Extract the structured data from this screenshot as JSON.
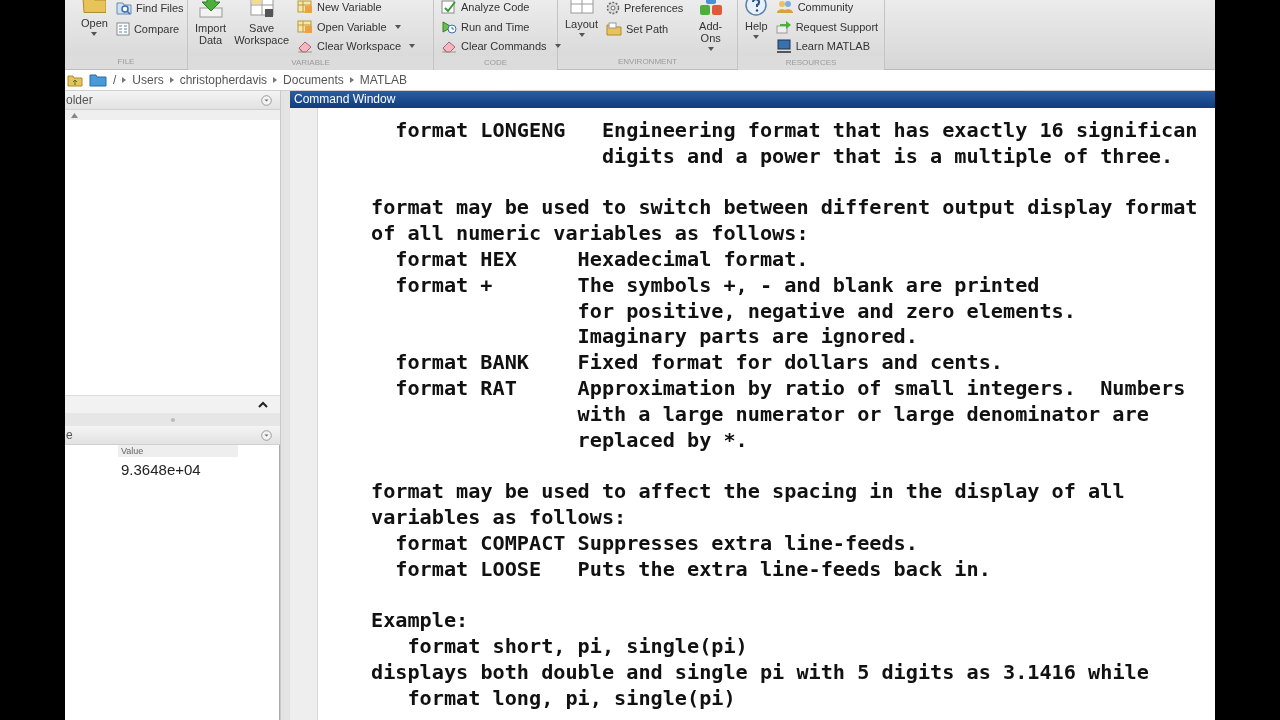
{
  "ribbon": {
    "groups": [
      {
        "label": "FILE",
        "items": [
          {
            "kind": "large",
            "label": [
              "Open"
            ],
            "caret": true
          },
          {
            "kind": "stack",
            "items": [
              {
                "label": "Find Files",
                "caret": false
              },
              {
                "label": "Compare",
                "caret": false
              }
            ]
          }
        ]
      },
      {
        "label": "VARIABLE",
        "items": [
          {
            "kind": "large",
            "label": [
              "Import",
              "Data"
            ],
            "caret": false
          },
          {
            "kind": "large",
            "label": [
              "Save",
              "Workspace"
            ],
            "caret": false
          },
          {
            "kind": "stack",
            "items": [
              {
                "label": "New Variable",
                "caret": false
              },
              {
                "label": "Open Variable",
                "caret": true
              },
              {
                "label": "Clear Workspace",
                "caret": true
              }
            ]
          }
        ]
      },
      {
        "label": "CODE",
        "items": [
          {
            "kind": "stack",
            "items": [
              {
                "label": "Analyze Code",
                "caret": false
              },
              {
                "label": "Run and Time",
                "caret": false
              },
              {
                "label": "Clear Commands",
                "caret": true
              }
            ]
          }
        ]
      },
      {
        "label": "ENVIRONMENT",
        "items": [
          {
            "kind": "large",
            "label": [
              "Layout"
            ],
            "caret": true
          },
          {
            "kind": "stack",
            "items": [
              {
                "label": "Preferences",
                "caret": false
              },
              {
                "label": "Set Path",
                "caret": false
              }
            ]
          },
          {
            "kind": "large",
            "label": [
              "Add-Ons"
            ],
            "caret": true
          }
        ]
      },
      {
        "label": "RESOURCES",
        "items": [
          {
            "kind": "large",
            "label": [
              "Help"
            ],
            "caret": true
          },
          {
            "kind": "stack",
            "items": [
              {
                "label": "Community",
                "caret": false
              },
              {
                "label": "Request Support",
                "caret": false
              },
              {
                "label": "Learn MATLAB",
                "caret": false
              }
            ]
          }
        ]
      }
    ]
  },
  "address_bar": {
    "path": [
      "/",
      "Users",
      "christopherdavis",
      "Documents",
      "MATLAB"
    ]
  },
  "current_folder": {
    "title": "older"
  },
  "workspace": {
    "title": "e",
    "columns": [
      "Value"
    ],
    "rows": [
      [
        "9.3648e+04"
      ]
    ]
  },
  "command_window": {
    "title": "Command Window",
    "blocks": [
      {
        "kind": "option_wide",
        "name": "format LONGENG",
        "lines": [
          "Engineering format that has exactly 16 significan",
          "digits and a power that is a multiple of three."
        ]
      },
      {
        "kind": "blank"
      },
      {
        "kind": "text",
        "text": "format may be used to switch between different output display format"
      },
      {
        "kind": "text",
        "text": "of all numeric variables as follows:"
      },
      {
        "kind": "option",
        "name": "format HEX",
        "lines": [
          "Hexadecimal format."
        ]
      },
      {
        "kind": "option",
        "name": "format +",
        "lines": [
          "The symbols +, - and blank are printed",
          "for positive, negative and zero elements.",
          "Imaginary parts are ignored."
        ]
      },
      {
        "kind": "option",
        "name": "format BANK",
        "lines": [
          "Fixed format for dollars and cents."
        ]
      },
      {
        "kind": "option",
        "name": "format RAT",
        "lines": [
          "Approximation by ratio of small integers.  Numbers",
          "with a large numerator or large denominator are",
          "replaced by *."
        ]
      },
      {
        "kind": "blank"
      },
      {
        "kind": "text",
        "text": "format may be used to affect the spacing in the display of all"
      },
      {
        "kind": "text",
        "text": "variables as follows:"
      },
      {
        "kind": "option",
        "name": "format COMPACT",
        "lines": [
          "Suppresses extra line-feeds."
        ]
      },
      {
        "kind": "option",
        "name": "format LOOSE",
        "lines": [
          "Puts the extra line-feeds back in."
        ]
      },
      {
        "kind": "blank"
      },
      {
        "kind": "text",
        "text": "Example:"
      },
      {
        "kind": "code",
        "text": "format short, pi, single(pi)"
      },
      {
        "kind": "text",
        "text": "displays both double and single pi with 5 digits as 3.1416 while"
      },
      {
        "kind": "code",
        "text": "format long, pi, single(pi)"
      }
    ]
  }
}
